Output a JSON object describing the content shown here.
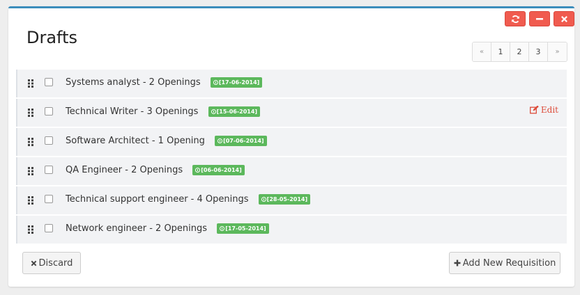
{
  "panel": {
    "title": "Drafts",
    "tools": [
      {
        "name": "refresh-icon"
      },
      {
        "name": "minus-icon"
      },
      {
        "name": "close-icon"
      }
    ]
  },
  "pagination": {
    "prev": "«",
    "pages": [
      "1",
      "2",
      "3"
    ],
    "next": "»"
  },
  "drafts": [
    {
      "title": "Systems analyst - 2 Openings",
      "date": "[17-06-2014]"
    },
    {
      "title": "Technical Writer - 3 Openings",
      "date": "[15-06-2014]",
      "action": "Edit"
    },
    {
      "title": "Software Architect - 1 Opening",
      "date": "[07-06-2014]"
    },
    {
      "title": "QA Engineer - 2 Openings",
      "date": "[06-06-2014]"
    },
    {
      "title": "Technical support engineer - 4 Openings",
      "date": "[28-05-2014]"
    },
    {
      "title": "Network engineer - 2 Openings",
      "date": "[17-05-2014]"
    }
  ],
  "footer": {
    "discard_label": "Discard",
    "add_label": "Add New Requisition"
  },
  "colors": {
    "accent": "#3c8dbc",
    "tool_button": "#f05b4f",
    "badge": "#5cb85c",
    "edit_link": "#dd4b39"
  }
}
